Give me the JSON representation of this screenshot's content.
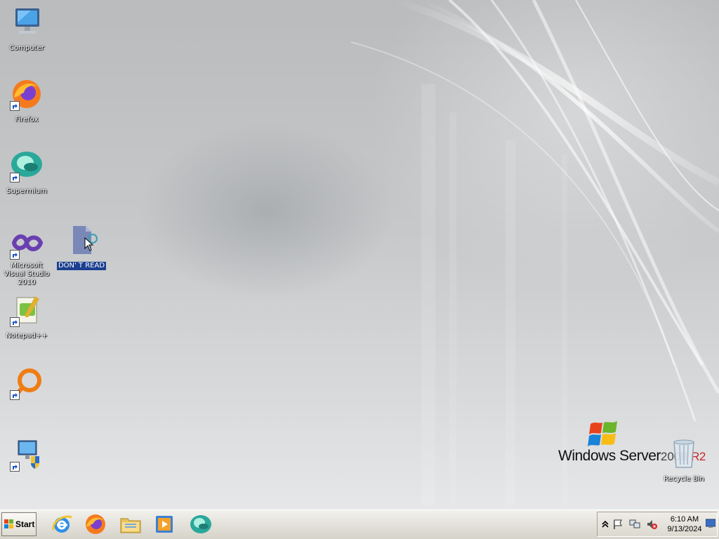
{
  "desktop": {
    "icons": [
      {
        "label": "Computer"
      },
      {
        "label": "Firefox"
      },
      {
        "label": "Supermium"
      },
      {
        "label": "Microsoft Visual Studio 2010"
      },
      {
        "label": "DON' T READ"
      },
      {
        "label": "Notepad++"
      },
      {
        "label": ""
      },
      {
        "label": ""
      },
      {
        "label": "Recycle Bin"
      }
    ],
    "brand": {
      "windows": "Windows Server",
      "version": "2008",
      "edition": "R2"
    }
  },
  "taskbar": {
    "start_label": "Start",
    "pinned": [
      "internet-explorer-icon",
      "firefox-icon",
      "file-explorer-icon",
      "media-player-icon",
      "supermium-icon"
    ],
    "clock": {
      "time": "6:10 AM",
      "date": "9/13/2024"
    }
  },
  "colors": {
    "selection": "#1c3f8f",
    "taskbar": "#e3e1da",
    "firefox_orange": "#f57a1f",
    "supermium_teal": "#2aa89a",
    "vs_purple": "#6a3fb0"
  }
}
